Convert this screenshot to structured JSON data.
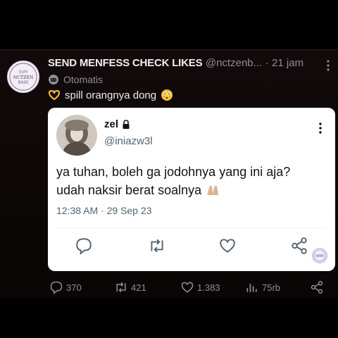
{
  "tweet": {
    "display_name": "SEND MENFESS CHECK LIKES",
    "handle": "@nctzenb...",
    "separator": "·",
    "time": "21 jam",
    "automated_label": "Otomatis",
    "text": "spill orangnya dong",
    "avatar_icon": "nctzen-base-logo-icon",
    "more_icon": "more-vertical-icon"
  },
  "quoted": {
    "name": "zel",
    "handle": "@iniazw3l",
    "text_line1": "ya tuhan, boleh ga jodohnya yang ini aja?",
    "text_line2": "udah naksir berat soalnya",
    "timestamp": "12:38 AM · 29 Sep 23",
    "icons": [
      "reply-icon",
      "retweet-icon",
      "like-icon",
      "share-icon"
    ]
  },
  "actions": {
    "replies": "370",
    "retweets": "421",
    "likes": "1.383",
    "views": "75rb"
  },
  "colors": {
    "background": "#000000",
    "card": "#ffffff",
    "muted": "#8b8f94",
    "card_text": "#0f1419"
  }
}
